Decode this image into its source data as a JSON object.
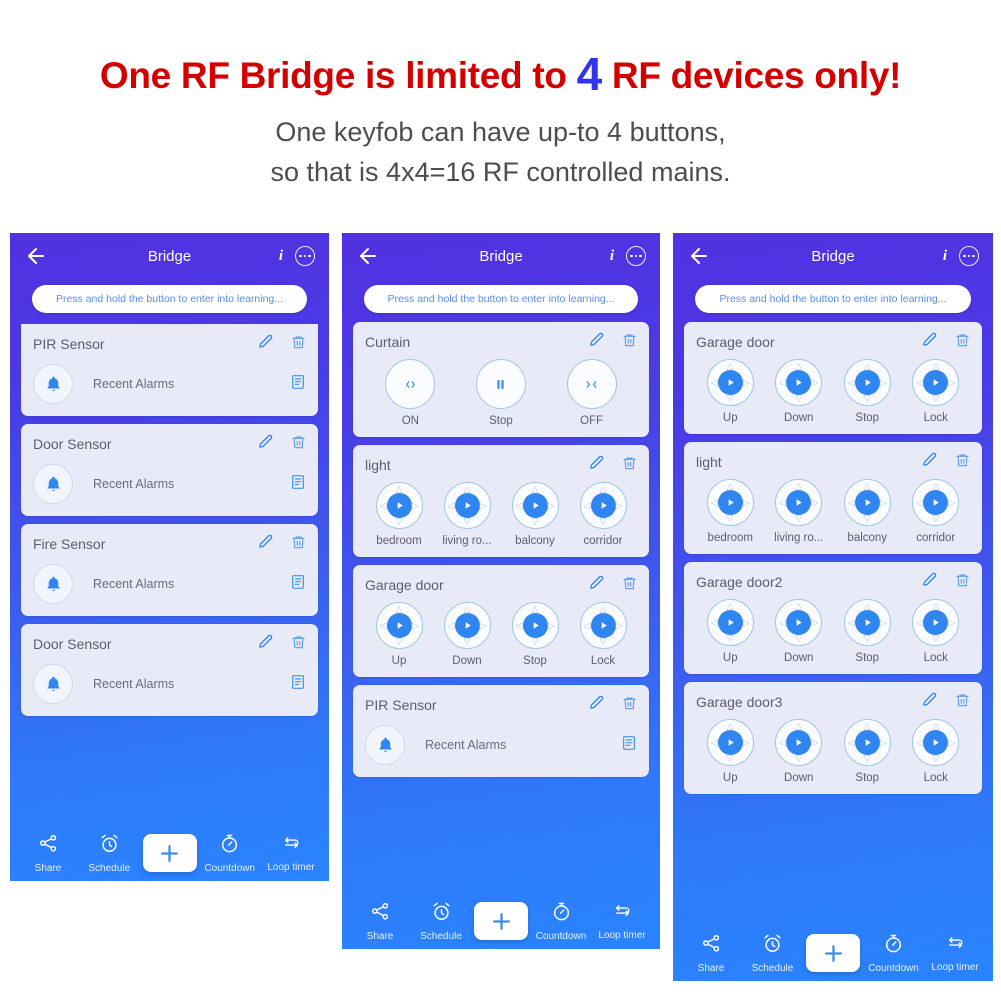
{
  "headline": {
    "before": "One RF Bridge is limited to ",
    "number": "4",
    "after": " RF devices only!"
  },
  "subtitle": {
    "line1": "One keyfob can have up-to 4 buttons,",
    "line2": "so that is 4x4=16 RF controlled mains."
  },
  "colors": {
    "headline_red": "#d40000",
    "headline_number_blue": "#3333ee",
    "subtitle_gray": "#4d4d4d",
    "panel_gradient_start": "#5231e0",
    "panel_gradient_end": "#2a84ff",
    "card_bg": "#e9eaf8",
    "accent_blue": "#2f86f0"
  },
  "common": {
    "topbar_title": "Bridge",
    "learning_hint": "Press and hold the button to enter into learning...",
    "icons": {
      "back": "back-arrow-icon",
      "info": "info-icon",
      "more": "more-options-icon",
      "edit": "edit-pencil-icon",
      "delete": "trash-icon",
      "bell": "bell-icon",
      "log": "log-list-icon"
    },
    "bottom_nav": [
      {
        "label": "Share",
        "icon": "share-icon"
      },
      {
        "label": "Schedule",
        "icon": "alarm-clock-icon"
      },
      {
        "label": "",
        "icon": "plus-icon"
      },
      {
        "label": "Countdown",
        "icon": "stopwatch-icon"
      },
      {
        "label": "Loop timer",
        "icon": "loop-timer-icon"
      }
    ]
  },
  "panels": [
    {
      "id": "panel-1",
      "cards": [
        {
          "type": "sensor",
          "title": "PIR Sensor",
          "row_label": "Recent Alarms",
          "clipped": true
        },
        {
          "type": "sensor",
          "title": "Door Sensor",
          "row_label": "Recent Alarms"
        },
        {
          "type": "sensor",
          "title": "Fire Sensor",
          "row_label": "Recent Alarms"
        },
        {
          "type": "sensor",
          "title": "Door Sensor",
          "row_label": "Recent Alarms"
        }
      ]
    },
    {
      "id": "panel-2",
      "cards": [
        {
          "type": "curtain",
          "title": "Curtain",
          "buttons": [
            {
              "caption": "ON",
              "glyph": "open-arrows-icon"
            },
            {
              "caption": "Stop",
              "glyph": "pause-icon"
            },
            {
              "caption": "OFF",
              "glyph": "close-arrows-icon"
            }
          ]
        },
        {
          "type": "remote",
          "title": "light",
          "buttons": [
            {
              "caption": "bedroom"
            },
            {
              "caption": "living ro..."
            },
            {
              "caption": "balcony"
            },
            {
              "caption": "corridor"
            }
          ]
        },
        {
          "type": "remote",
          "title": "Garage door",
          "buttons": [
            {
              "caption": "Up"
            },
            {
              "caption": "Down"
            },
            {
              "caption": "Stop"
            },
            {
              "caption": "Lock"
            }
          ]
        },
        {
          "type": "sensor",
          "title": "PIR Sensor",
          "row_label": "Recent Alarms"
        }
      ]
    },
    {
      "id": "panel-3",
      "cards": [
        {
          "type": "remote",
          "title": "Garage door",
          "buttons": [
            {
              "caption": "Up"
            },
            {
              "caption": "Down"
            },
            {
              "caption": "Stop"
            },
            {
              "caption": "Lock"
            }
          ]
        },
        {
          "type": "remote",
          "title": "light",
          "buttons": [
            {
              "caption": "bedroom"
            },
            {
              "caption": "living ro..."
            },
            {
              "caption": "balcony"
            },
            {
              "caption": "corridor"
            }
          ]
        },
        {
          "type": "remote",
          "title": "Garage door2",
          "buttons": [
            {
              "caption": "Up"
            },
            {
              "caption": "Down"
            },
            {
              "caption": "Stop"
            },
            {
              "caption": "Lock"
            }
          ]
        },
        {
          "type": "remote",
          "title": "Garage door3",
          "buttons": [
            {
              "caption": "Up"
            },
            {
              "caption": "Down"
            },
            {
              "caption": "Stop"
            },
            {
              "caption": "Lock"
            }
          ]
        }
      ]
    }
  ]
}
